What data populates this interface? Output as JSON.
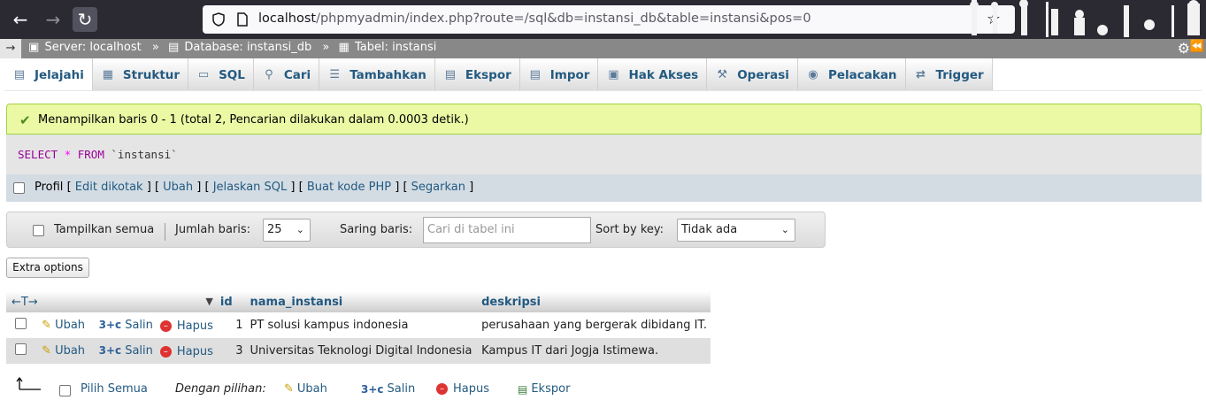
{
  "browser": {
    "url_host": "localhost",
    "url_rest": "/phpmyadmin/index.php?route=/sql&db=instansi_db&table=instansi&pos=0"
  },
  "breadcrumb": {
    "server": "Server: localhost",
    "database": "Database: instansi_db",
    "table": "Tabel: instansi"
  },
  "tabs": [
    {
      "label": "Jelajahi",
      "icon": "browse-icon"
    },
    {
      "label": "Struktur",
      "icon": "structure-icon"
    },
    {
      "label": "SQL",
      "icon": "sql-icon"
    },
    {
      "label": "Cari",
      "icon": "search-icon"
    },
    {
      "label": "Tambahkan",
      "icon": "insert-icon"
    },
    {
      "label": "Ekspor",
      "icon": "export-icon"
    },
    {
      "label": "Impor",
      "icon": "import-icon"
    },
    {
      "label": "Hak Akses",
      "icon": "privileges-icon"
    },
    {
      "label": "Operasi",
      "icon": "wrench-icon"
    },
    {
      "label": "Pelacakan",
      "icon": "eye-icon"
    },
    {
      "label": "Trigger",
      "icon": "trigger-icon"
    }
  ],
  "success_message": "Menampilkan baris 0 - 1 (total 2, Pencarian dilakukan dalam 0.0003 detik.)",
  "sql": {
    "select": "SELECT",
    "star": "*",
    "from": "FROM",
    "table": "`instansi`"
  },
  "sql_links": {
    "profil": "Profil",
    "edit_inline": "Edit dikotak",
    "edit": "Ubah",
    "explain": "Jelaskan SQL",
    "php": "Buat kode PHP",
    "refresh": "Segarkan"
  },
  "nav": {
    "show_all": "Tampilkan semua",
    "rows_label": "Jumlah baris:",
    "rows_value": "25",
    "filter_label": "Saring baris:",
    "filter_placeholder": "Cari di tabel ini",
    "sort_label": "Sort by key:",
    "sort_value": "Tidak ada"
  },
  "extra_options": "Extra options",
  "table": {
    "col_arrows": "←T→",
    "columns": [
      "id",
      "nama_instansi",
      "deskripsi"
    ],
    "action_edit": "Ubah",
    "action_copy": "Salin",
    "action_delete": "Hapus",
    "rows": [
      {
        "id": "1",
        "nama_instansi": "PT solusi kampus indonesia",
        "deskripsi": "perusahaan yang bergerak dibidang IT."
      },
      {
        "id": "3",
        "nama_instansi": "Universitas Teknologi Digital Indonesia",
        "deskripsi": "Kampus IT dari Jogja Istimewa."
      }
    ]
  },
  "bulk": {
    "check_all": "Pilih Semua",
    "with_selected": "Dengan pilihan:",
    "edit": "Ubah",
    "copy": "Salin",
    "delete": "Hapus",
    "export": "Ekspor"
  }
}
